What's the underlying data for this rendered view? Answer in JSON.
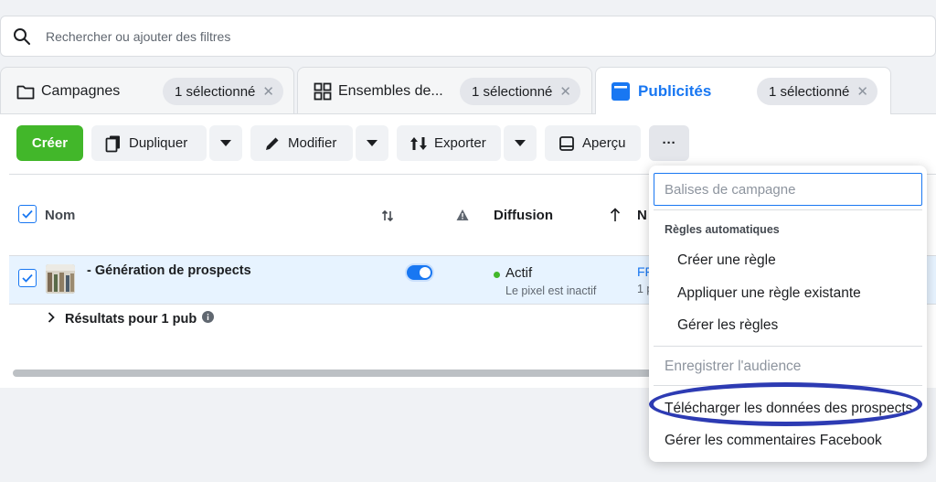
{
  "search": {
    "placeholder": "Rechercher ou ajouter des filtres"
  },
  "tabs": [
    {
      "label": "Campagnes",
      "selection": "1 sélectionné",
      "icon": "folder-icon"
    },
    {
      "label": "Ensembles de...",
      "selection": "1 sélectionné",
      "icon": "grid-icon"
    },
    {
      "label": "Publicités",
      "selection": "1 sélectionné",
      "icon": "ad-icon"
    }
  ],
  "close_glyph": "✕",
  "toolbar": {
    "create_label": "Créer",
    "duplicate_label": "Dupliquer",
    "edit_label": "Modifier",
    "export_label": "Exporter",
    "preview_label": "Aperçu",
    "more_glyph": "···"
  },
  "table": {
    "headers": {
      "name": "Nom",
      "delivery": "Diffusion",
      "next": "N"
    },
    "row": {
      "name": "- Génération de prospects",
      "status": "Actif",
      "status_detail": "Le pixel est inactif",
      "trailing_top": "FF",
      "trailing_bottom": "1 p"
    },
    "results": "Résultats pour 1 pub"
  },
  "menu": {
    "tag_placeholder": "Balises de campagne",
    "section_title": "Règles automatiques",
    "items": [
      "Créer une règle",
      "Appliquer une règle existante",
      "Gérer les règles"
    ],
    "save_audience": "Enregistrer l'audience",
    "download_leads": "Télécharger les données des prospects",
    "manage_comments": "Gérer les commentaires Facebook"
  },
  "colors": {
    "brand": "#1877f2",
    "create": "#42b72a",
    "active": "#42b72a",
    "highlight": "#2d3bb3"
  }
}
